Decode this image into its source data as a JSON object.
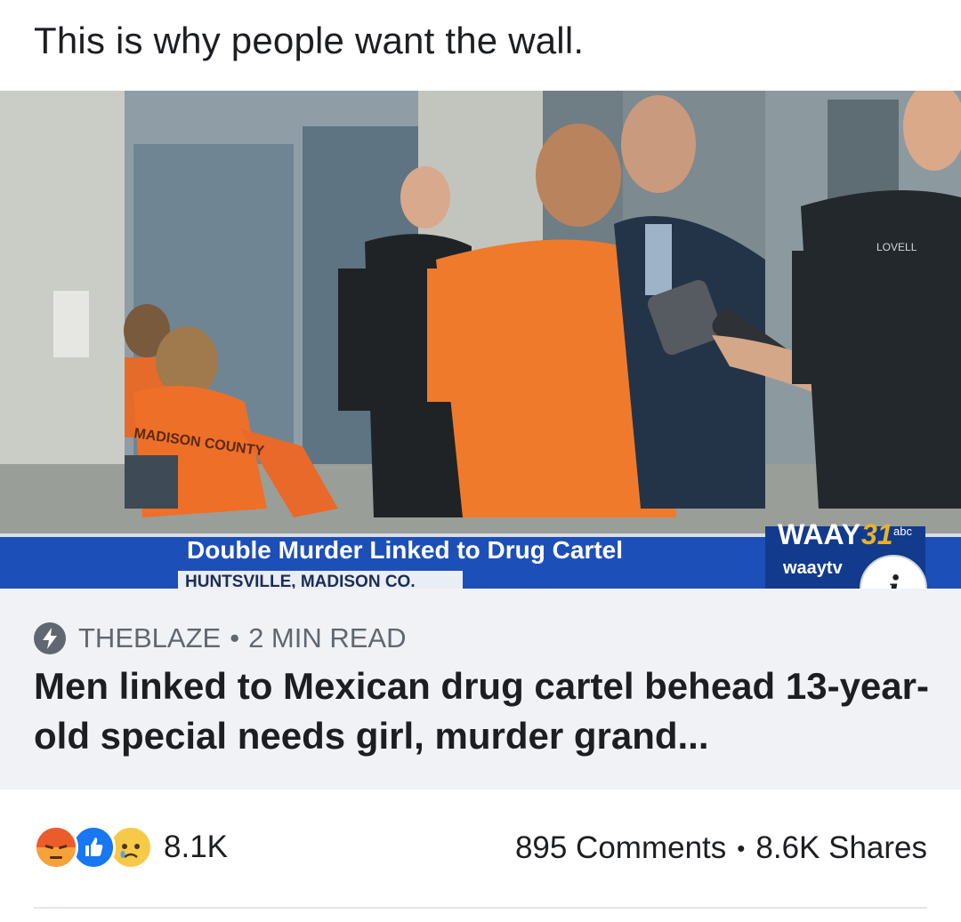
{
  "post": {
    "text": "This is why people want the wall."
  },
  "media": {
    "chyron_headline": "Double Murder Linked to Drug Cartel",
    "chyron_location": "HUNTSVILLE, MADISON CO.",
    "station_logo": "WAAY",
    "station_number": "31",
    "network_bug": "abc",
    "station_handle": "waaytv",
    "shirt_text": "MADISON COUNTY",
    "uniform_tag": "LOVELL",
    "info_icon": "i"
  },
  "link": {
    "source": "THEBLAZE",
    "read_time": "2 MIN READ",
    "separator": "•",
    "headline": "Men linked to Mexican drug cartel behead 13-year-old special needs girl, murder grand..."
  },
  "footer": {
    "reactions": [
      "angry-icon",
      "like-icon",
      "sad-icon"
    ],
    "reaction_count": "8.1K",
    "comments": "895 Comments",
    "separator": "•",
    "shares": "8.6K Shares"
  },
  "colors": {
    "text_primary": "#1c1e21",
    "text_secondary": "#606770",
    "card_bg": "#f0f2f5",
    "like_blue": "#1877f2",
    "angry": "#f05a28",
    "sad": "#f7c948"
  }
}
